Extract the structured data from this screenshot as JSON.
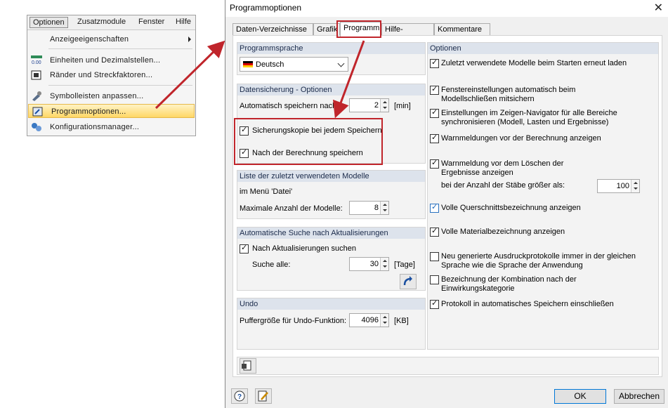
{
  "menu": {
    "bar": [
      "Optionen",
      "Zusatzmodule",
      "Fenster",
      "Hilfe"
    ],
    "items": [
      {
        "label": "Anzeigeeigenschaften",
        "icon": "none",
        "submenu": true
      },
      {
        "label": "Einheiten und Dezimalstellen...",
        "icon": "units-icon",
        "icon_text": "0.00"
      },
      {
        "label": "Ränder und Streckfaktoren...",
        "icon": "margins-icon"
      },
      {
        "label": "Symbolleisten anpassen...",
        "icon": "toolbar-customize-icon"
      },
      {
        "label": "Programmoptionen...",
        "icon": "program-options-icon",
        "highlighted": true
      },
      {
        "label": "Konfigurationsmanager...",
        "icon": "configuration-manager-icon"
      }
    ]
  },
  "dialog": {
    "title": "Programmoptionen",
    "close": "✕",
    "tabs": [
      "Daten-Verzeichnisse",
      "Grafik",
      "Programm",
      "Hilfe-Assistent",
      "Kommentare"
    ],
    "active_tab": "Programm",
    "language": {
      "header": "Programmsprache",
      "selected": "Deutsch"
    },
    "backup": {
      "header": "Datensicherung - Optionen",
      "autosave_label": "Automatisch speichern nach:",
      "autosave_value": "2",
      "autosave_unit": "[min]",
      "backup_copy_label": "Sicherungskopie bei jedem Speichern",
      "save_after_calc_label": "Nach der Berechnung speichern"
    },
    "recent": {
      "header": "Liste der zuletzt verwendeten Modelle",
      "menu_label": "im Menü 'Datei'",
      "max_label": "Maximale Anzahl der Modelle:",
      "max_value": "8"
    },
    "updates": {
      "header": "Automatische Suche nach Aktualisierungen",
      "search_label": "Nach Aktualisierungen suchen",
      "interval_label": "Suche alle:",
      "interval_value": "30",
      "interval_unit": "[Tage]"
    },
    "undo": {
      "header": "Undo",
      "buffer_label": "Puffergröße für Undo-Funktion:",
      "buffer_value": "4096",
      "buffer_unit": "[KB]"
    },
    "options": {
      "header": "Optionen",
      "items": [
        "Zuletzt verwendete Modelle beim Starten erneut laden",
        "Fenstereinstellungen automatisch beim Modellschließen mitsichern",
        "Einstellungen im Zeigen-Navigator für alle Bereiche synchronisieren (Modell, Lasten und Ergebnisse)",
        "Warnmeldungen vor der Berechnung anzeigen",
        "Warnmeldung vor dem Löschen der Ergebnisse anzeigen",
        "Volle Querschnittsbezeichnung anzeigen",
        "Volle Materialbezeichnung anzeigen",
        "Neu generierte Ausdruckprotokolle immer in der gleichen Sprache wie die Sprache der Anwendung",
        "Bezeichnung der Kombination nach der Einwirkungskategorie",
        "Protokoll in automatisches Speichern einschließen"
      ],
      "checked": [
        true,
        true,
        true,
        true,
        true,
        true,
        true,
        false,
        false,
        true
      ],
      "bar_count_label": "bei der Anzahl der Stäbe größer als:",
      "bar_count_value": "100"
    },
    "buttons": {
      "ok": "OK",
      "cancel": "Abbrechen"
    },
    "colors": {
      "highlight_box": "#c0252b",
      "group_header": "#dde3ec"
    }
  }
}
